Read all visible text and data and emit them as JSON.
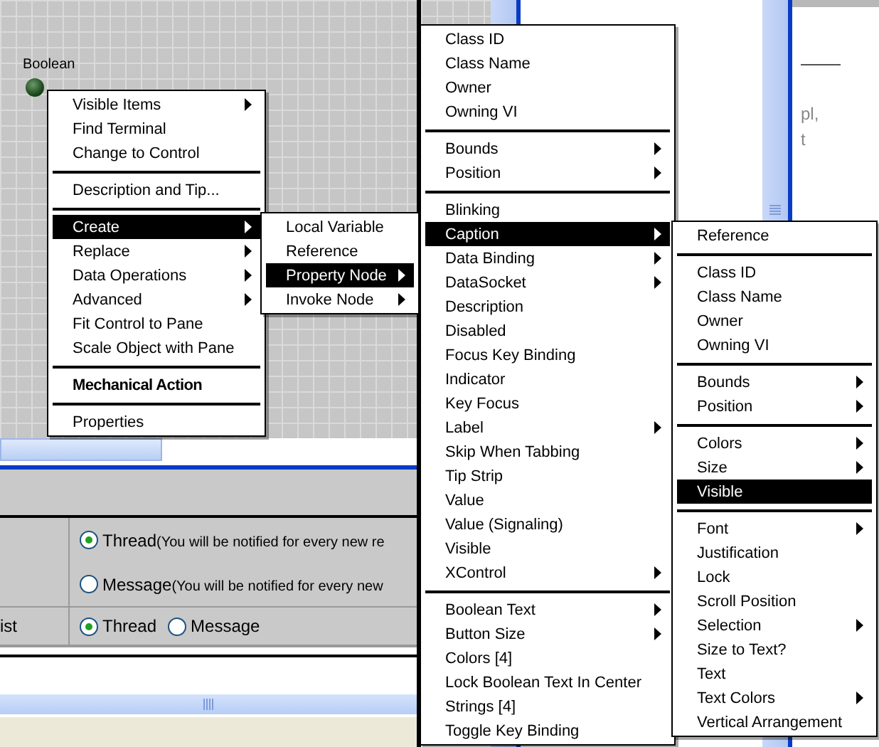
{
  "canvas": {
    "label": "Boolean"
  },
  "background_fragments": [
    "pl,",
    "t"
  ],
  "form": {
    "rows": [
      {
        "options": [
          {
            "label": "Thread",
            "note": "(You will be notified for every new re",
            "selected": true
          },
          {
            "label": "Message",
            "note": "(You will be notified for every new",
            "selected": false
          }
        ]
      },
      {
        "label": "ist",
        "options": [
          {
            "label": "Thread",
            "selected": true
          },
          {
            "label": "Message",
            "selected": false
          }
        ]
      }
    ]
  },
  "menus": [
    {
      "items": [
        {
          "kind": "submenu",
          "label": "Visible Items",
          "selected": false
        },
        {
          "kind": "item",
          "label": "Find Terminal",
          "selected": false
        },
        {
          "kind": "item",
          "label": "Change to Control",
          "selected": false
        },
        {
          "kind": "separator"
        },
        {
          "kind": "item",
          "label": "Description and Tip...",
          "selected": false
        },
        {
          "kind": "separator"
        },
        {
          "kind": "submenu",
          "label": "Create",
          "selected": true
        },
        {
          "kind": "submenu",
          "label": "Replace",
          "selected": false
        },
        {
          "kind": "submenu",
          "label": "Data Operations",
          "selected": false
        },
        {
          "kind": "submenu",
          "label": "Advanced",
          "selected": false
        },
        {
          "kind": "item",
          "label": "Fit Control to Pane",
          "selected": false
        },
        {
          "kind": "item",
          "label": "Scale Object with Pane",
          "selected": false
        },
        {
          "kind": "separator"
        },
        {
          "kind": "bold",
          "label": "Mechanical Action",
          "selected": false
        },
        {
          "kind": "separator"
        },
        {
          "kind": "item",
          "label": "Properties",
          "selected": false
        }
      ]
    },
    {
      "items": [
        {
          "kind": "item",
          "label": "Local Variable",
          "selected": false
        },
        {
          "kind": "item",
          "label": "Reference",
          "selected": false
        },
        {
          "kind": "submenu",
          "label": "Property Node",
          "selected": true
        },
        {
          "kind": "submenu",
          "label": "Invoke Node",
          "selected": false
        }
      ]
    },
    {
      "items": [
        {
          "kind": "item",
          "label": "Class ID",
          "selected": false
        },
        {
          "kind": "item",
          "label": "Class Name",
          "selected": false
        },
        {
          "kind": "item",
          "label": "Owner",
          "selected": false
        },
        {
          "kind": "item",
          "label": "Owning VI",
          "selected": false
        },
        {
          "kind": "separator"
        },
        {
          "kind": "submenu",
          "label": "Bounds",
          "selected": false
        },
        {
          "kind": "submenu",
          "label": "Position",
          "selected": false
        },
        {
          "kind": "separator"
        },
        {
          "kind": "item",
          "label": "Blinking",
          "selected": false
        },
        {
          "kind": "submenu",
          "label": "Caption",
          "selected": true
        },
        {
          "kind": "submenu",
          "label": "Data Binding",
          "selected": false
        },
        {
          "kind": "submenu",
          "label": "DataSocket",
          "selected": false
        },
        {
          "kind": "item",
          "label": "Description",
          "selected": false
        },
        {
          "kind": "item",
          "label": "Disabled",
          "selected": false
        },
        {
          "kind": "item",
          "label": "Focus Key Binding",
          "selected": false
        },
        {
          "kind": "item",
          "label": "Indicator",
          "selected": false
        },
        {
          "kind": "item",
          "label": "Key Focus",
          "selected": false
        },
        {
          "kind": "submenu",
          "label": "Label",
          "selected": false
        },
        {
          "kind": "item",
          "label": "Skip When Tabbing",
          "selected": false
        },
        {
          "kind": "item",
          "label": "Tip Strip",
          "selected": false
        },
        {
          "kind": "item",
          "label": "Value",
          "selected": false
        },
        {
          "kind": "item",
          "label": "Value (Signaling)",
          "selected": false
        },
        {
          "kind": "item",
          "label": "Visible",
          "selected": false
        },
        {
          "kind": "submenu",
          "label": "XControl",
          "selected": false
        },
        {
          "kind": "separator"
        },
        {
          "kind": "submenu",
          "label": "Boolean Text",
          "selected": false
        },
        {
          "kind": "submenu",
          "label": "Button Size",
          "selected": false
        },
        {
          "kind": "item",
          "label": "Colors [4]",
          "selected": false
        },
        {
          "kind": "item",
          "label": "Lock Boolean Text In Center",
          "selected": false
        },
        {
          "kind": "item",
          "label": "Strings [4]",
          "selected": false
        },
        {
          "kind": "item",
          "label": "Toggle Key Binding",
          "selected": false
        }
      ]
    },
    {
      "items": [
        {
          "kind": "item",
          "label": "Reference",
          "selected": false
        },
        {
          "kind": "separator"
        },
        {
          "kind": "item",
          "label": "Class ID",
          "selected": false
        },
        {
          "kind": "item",
          "label": "Class Name",
          "selected": false
        },
        {
          "kind": "item",
          "label": "Owner",
          "selected": false
        },
        {
          "kind": "item",
          "label": "Owning VI",
          "selected": false
        },
        {
          "kind": "separator"
        },
        {
          "kind": "submenu",
          "label": "Bounds",
          "selected": false
        },
        {
          "kind": "submenu",
          "label": "Position",
          "selected": false
        },
        {
          "kind": "separator"
        },
        {
          "kind": "submenu",
          "label": "Colors",
          "selected": false
        },
        {
          "kind": "submenu",
          "label": "Size",
          "selected": false
        },
        {
          "kind": "item",
          "label": "Visible",
          "selected": true
        },
        {
          "kind": "separator"
        },
        {
          "kind": "submenu",
          "label": "Font",
          "selected": false
        },
        {
          "kind": "item",
          "label": "Justification",
          "selected": false
        },
        {
          "kind": "item",
          "label": "Lock",
          "selected": false
        },
        {
          "kind": "item",
          "label": "Scroll Position",
          "selected": false
        },
        {
          "kind": "submenu",
          "label": "Selection",
          "selected": false
        },
        {
          "kind": "item",
          "label": "Size to Text?",
          "selected": false
        },
        {
          "kind": "item",
          "label": "Text",
          "selected": false
        },
        {
          "kind": "submenu",
          "label": "Text Colors",
          "selected": false
        },
        {
          "kind": "item",
          "label": "Vertical Arrangement",
          "selected": false
        }
      ]
    }
  ]
}
